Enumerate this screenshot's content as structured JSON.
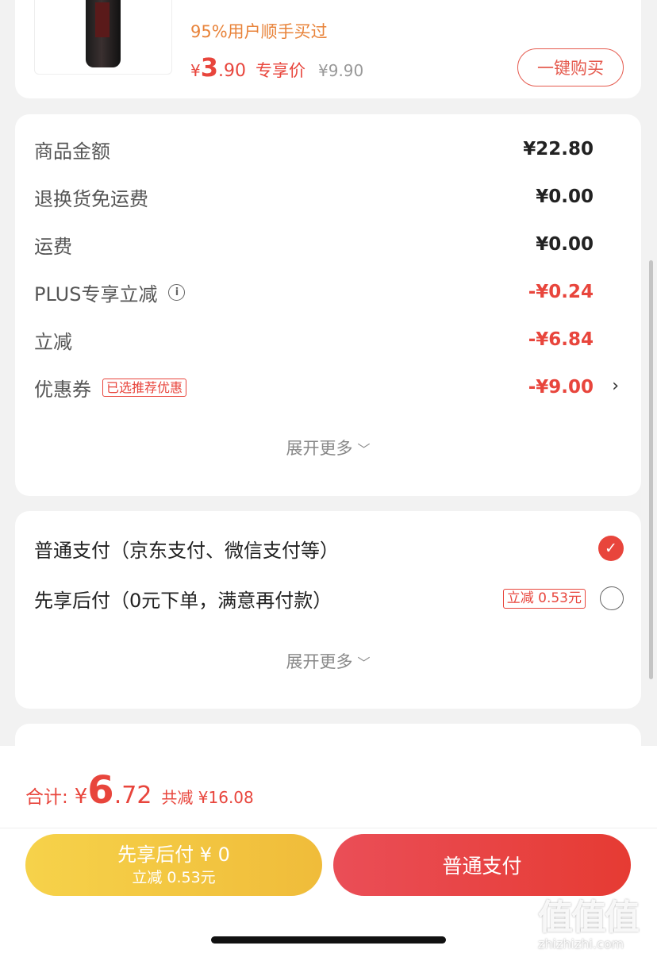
{
  "product": {
    "bought_text": "95%用户顺手买过",
    "price_symbol": "¥",
    "price_int": "3",
    "price_dec": ".90",
    "price_tag": "专享价",
    "orig_price": "¥9.90",
    "buy_button": "一键购买"
  },
  "amounts": {
    "rows": [
      {
        "label": "商品金额",
        "value": "¥22.80"
      },
      {
        "label": "退换货免运费",
        "value": "¥0.00"
      },
      {
        "label": "运费",
        "value": "¥0.00"
      },
      {
        "label": "PLUS专享立减",
        "value": "-¥0.24"
      },
      {
        "label": "立减",
        "value": "-¥6.84"
      },
      {
        "label": "优惠券",
        "value": "-¥9.00",
        "badge": "已选推荐优惠"
      }
    ],
    "expand_more": "展开更多"
  },
  "payment": {
    "options": [
      {
        "label": "普通支付（京东支付、微信支付等）",
        "selected": true
      },
      {
        "label": "先享后付（0元下单，满意再付款）",
        "badge": "立减 0.53元",
        "selected": false
      }
    ],
    "expand_more": "展开更多"
  },
  "footer": {
    "total_label": "合计:",
    "total_symbol": "¥",
    "total_int": "6",
    "total_dec": ".72",
    "total_saved": "共减 ¥16.08",
    "pay_later_line1": "先享后付 ¥ 0",
    "pay_later_line2": "立减 0.53元",
    "pay_now": "普通支付"
  },
  "watermark": {
    "site": "zhizhizhi.com"
  },
  "colors": {
    "accent_red": "#e8453c",
    "accent_orange": "#e8833a",
    "pay_later_yellow": "#f6d24a"
  }
}
